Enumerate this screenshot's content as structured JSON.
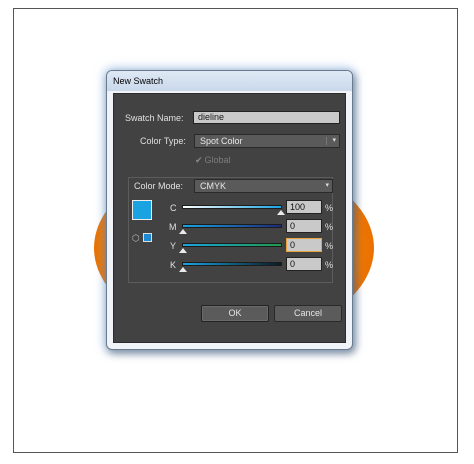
{
  "dialog": {
    "title": "New Swatch",
    "swatch_name_label": "Swatch Name:",
    "swatch_name_value": "dieline",
    "color_type_label": "Color Type:",
    "color_type_value": "Spot Color",
    "global_label": "Global",
    "global_checked": true,
    "color_mode_label": "Color Mode:",
    "color_mode_value": "CMYK",
    "preview_color": "#1aa3e0",
    "sliders": [
      {
        "label": "C",
        "value": "100",
        "unit": "%"
      },
      {
        "label": "M",
        "value": "0",
        "unit": "%"
      },
      {
        "label": "Y",
        "value": "0",
        "unit": "%"
      },
      {
        "label": "K",
        "value": "0",
        "unit": "%"
      }
    ],
    "ok_label": "OK",
    "cancel_label": "Cancel"
  },
  "icons": {
    "dropdown_arrow": "▾",
    "check": "✔",
    "cube": "⬡"
  },
  "colors": {
    "panel_bg": "#424242",
    "artwork_orange": "#f37d00"
  }
}
